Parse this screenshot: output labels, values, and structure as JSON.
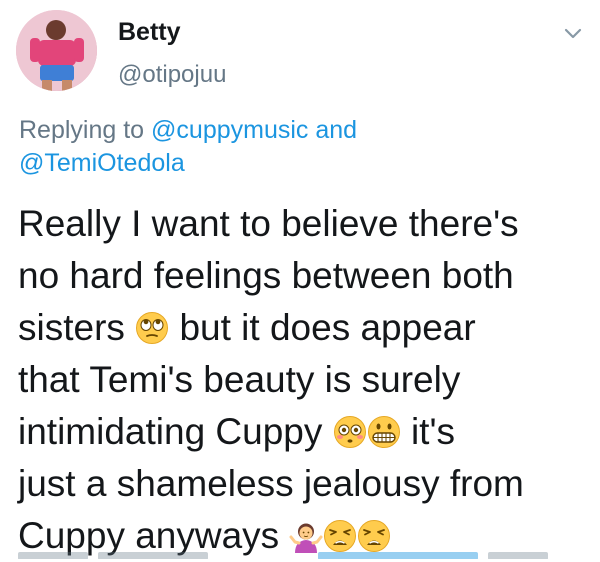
{
  "tweet": {
    "author_name": "Betty",
    "author_handle": "@otipojuu",
    "reply_prefix": "Replying to",
    "reply_mention_1": "@cuppymusic",
    "reply_and": "and",
    "reply_mention_2": "@TemiOtedola",
    "text": {
      "l1": "Really I want to believe there's",
      "l2": "no hard feelings between both",
      "l3a": "sisters",
      "l3b": "but it does appear",
      "l4": "that Temi's beauty is surely",
      "l5a": "intimidating Cuppy",
      "l5b": "it's",
      "l6": "just a shameless jealousy from",
      "l7a": "Cuppy anyways"
    }
  },
  "icons": {
    "caret": "chevron-down-icon",
    "emoji_1": "face-with-rolling-eyes",
    "emoji_2": "flushed-face",
    "emoji_3": "grimacing-face",
    "emoji_4": "person-shrugging",
    "emoji_5": "weary-face"
  },
  "colors": {
    "text": "#14171a",
    "secondary": "#657786",
    "link": "#1b95e0"
  }
}
